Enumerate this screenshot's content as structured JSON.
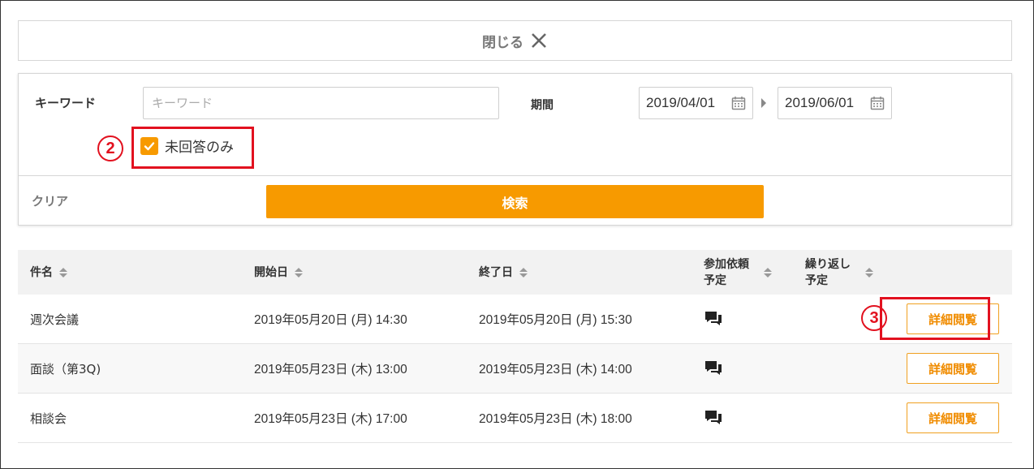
{
  "close_bar": {
    "label": "閉じる"
  },
  "search": {
    "keyword_label": "キーワード",
    "keyword_placeholder": "キーワード",
    "keyword_value": "",
    "period_label": "期間",
    "date_from": "2019/04/01",
    "date_to": "2019/06/01",
    "unanswered_only_label": "未回答のみ",
    "unanswered_only_checked": true,
    "clear_label": "クリア",
    "search_button_label": "検索"
  },
  "annotations": {
    "marker_2": "2",
    "marker_3": "3"
  },
  "table": {
    "headers": {
      "subject": "件名",
      "start": "開始日",
      "end": "終了日",
      "participation": "参加依頼\n予定",
      "recurring": "繰り返し\n予定"
    },
    "rows": [
      {
        "subject": "週次会議",
        "start": "2019年05月20日 (月) 14:30",
        "end": "2019年05月20日 (月) 15:30",
        "action": "詳細閲覧"
      },
      {
        "subject": "面談（第3Q)",
        "start": "2019年05月23日 (木) 13:00",
        "end": "2019年05月23日 (木) 14:00",
        "action": "詳細閲覧"
      },
      {
        "subject": "相談会",
        "start": "2019年05月23日 (木) 17:00",
        "end": "2019年05月23日 (木) 18:00",
        "action": "詳細閲覧"
      }
    ]
  },
  "colors": {
    "accent": "#f79a00",
    "annotation": "#e2111f"
  },
  "icons": {
    "close": "close-x-icon",
    "calendar": "calendar-icon",
    "comment": "speech-bubbles-icon",
    "sort": "sort-arrows-icon",
    "check": "checkmark-icon"
  }
}
